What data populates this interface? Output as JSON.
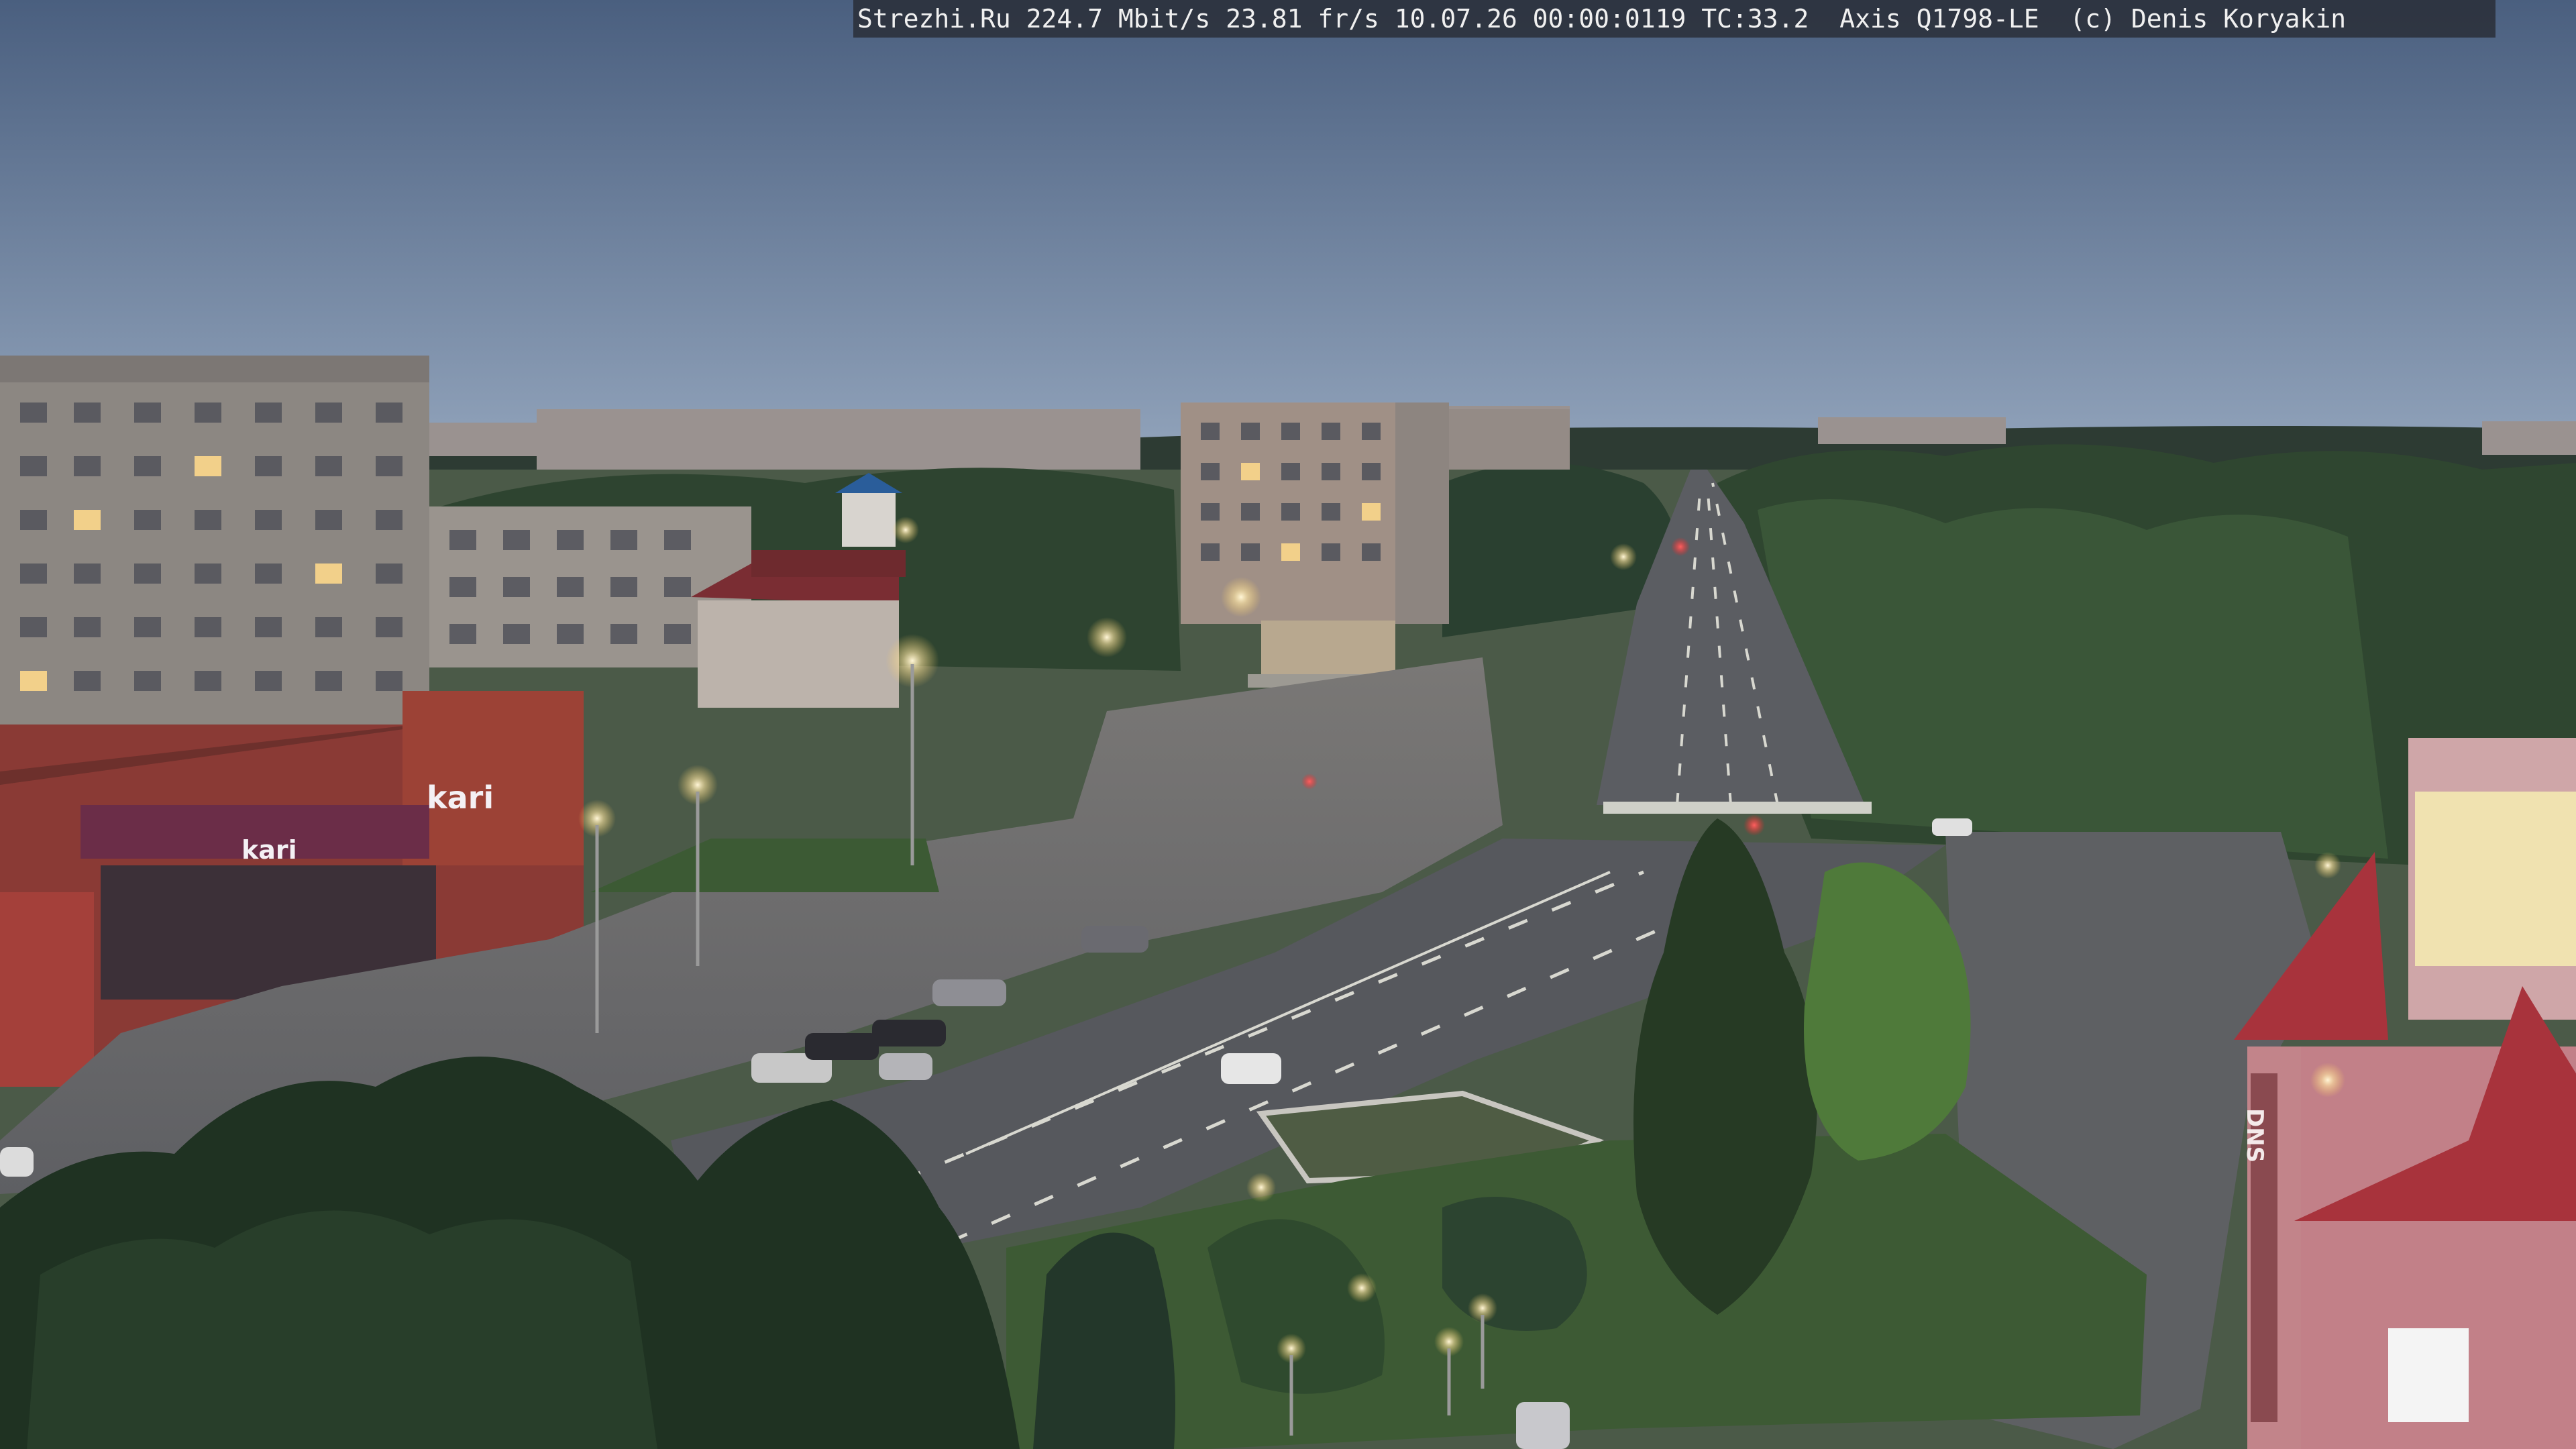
{
  "overlay": {
    "text": "Strezhi.Ru 224.7 Mbit/s 23.81 fr/s 10.07.26 00:00:0119 TC:33.2  Axis Q1798-LE  (c) Denis Koryakin"
  },
  "signs": {
    "store_left": "kari",
    "store_left_small": "kari",
    "store_right": "DNS"
  },
  "colors": {
    "sky_top": "#4a5f7f",
    "sky_bottom": "#8496b0",
    "road": "#55585e",
    "plaza": "#6b6c70",
    "trees": "#2b3f2c",
    "store_red": "#8a3a35",
    "roof_red": "#a8333c"
  }
}
